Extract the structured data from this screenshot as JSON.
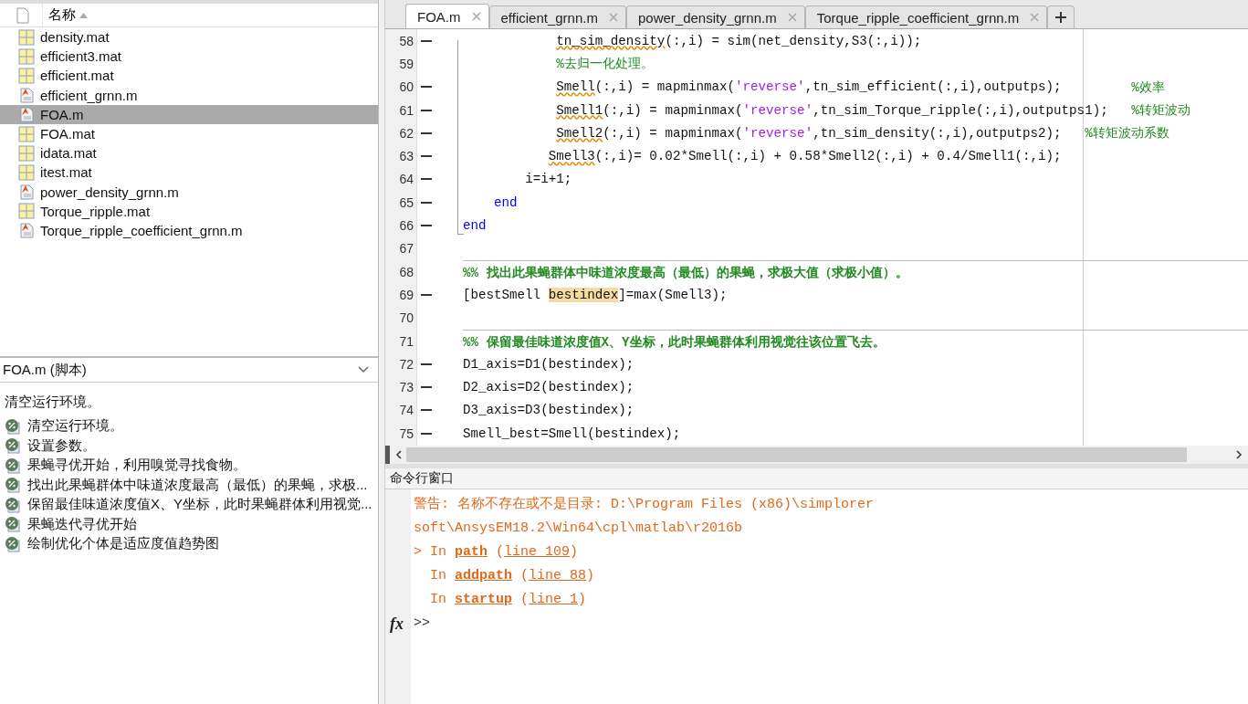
{
  "file_browser": {
    "column": "名称",
    "sort_ascending": true,
    "files": [
      {
        "name": "density.mat",
        "kind": "mat",
        "selected": false
      },
      {
        "name": "efficient3.mat",
        "kind": "mat",
        "selected": false
      },
      {
        "name": "efficient.mat",
        "kind": "mat",
        "selected": false
      },
      {
        "name": "efficient_grnn.m",
        "kind": "m",
        "selected": false
      },
      {
        "name": "FOA.m",
        "kind": "m",
        "selected": true
      },
      {
        "name": "FOA.mat",
        "kind": "mat",
        "selected": false
      },
      {
        "name": "idata.mat",
        "kind": "mat",
        "selected": false
      },
      {
        "name": "itest.mat",
        "kind": "mat",
        "selected": false
      },
      {
        "name": "power_density_grnn.m",
        "kind": "m",
        "selected": false
      },
      {
        "name": "Torque_ripple.mat",
        "kind": "mat",
        "selected": false
      },
      {
        "name": "Torque_ripple_coefficient_grnn.m",
        "kind": "m",
        "selected": false
      }
    ]
  },
  "details": {
    "title": "FOA.m  (脚本)",
    "description": "清空运行环境。",
    "sections": [
      "清空运行环境。",
      "设置参数。",
      "果蝇寻优开始，利用嗅觉寻找食物。",
      "找出此果蝇群体中味道浓度最高（最低）的果蝇，求极...",
      "保留最佳味道浓度值X、Y坐标，此时果蝇群体利用视觉...",
      "果蝇迭代寻优开始",
      "绘制优化个体是适应度值趋势图"
    ]
  },
  "tabs": [
    {
      "label": "FOA.m",
      "selected": true
    },
    {
      "label": "efficient_grnn.m",
      "selected": false
    },
    {
      "label": "power_density_grnn.m",
      "selected": false
    },
    {
      "label": "Torque_ripple_coefficient_grnn.m",
      "selected": false
    }
  ],
  "editor": {
    "lines": [
      {
        "number": "58",
        "executable": true,
        "kind": "code",
        "tokens": [
          {
            "text": "            tn_sim_density",
            "kind": "warn"
          },
          {
            "text": "(:,i) = sim(net_density,S3(:,i));",
            "kind": "plain"
          }
        ]
      },
      {
        "number": "59",
        "executable": false,
        "kind": "code",
        "tokens": [
          {
            "text": "            %去归一化处理。",
            "kind": "comment"
          }
        ]
      },
      {
        "number": "60",
        "executable": true,
        "kind": "code",
        "tokens": [
          {
            "text": "            Smell",
            "kind": "warn"
          },
          {
            "text": "(:,i) = mapminmax(",
            "kind": "plain"
          },
          {
            "text": "'reverse'",
            "kind": "string"
          },
          {
            "text": ",tn_sim_efficient(:,i),outputps);         ",
            "kind": "plain"
          },
          {
            "text": "%效率",
            "kind": "comment"
          }
        ]
      },
      {
        "number": "61",
        "executable": true,
        "kind": "code",
        "tokens": [
          {
            "text": "            Smell1",
            "kind": "warn"
          },
          {
            "text": "(:,i) = mapminmax(",
            "kind": "plain"
          },
          {
            "text": "'reverse'",
            "kind": "string"
          },
          {
            "text": ",tn_sim_Torque_ripple(:,i),outputps1);   ",
            "kind": "plain"
          },
          {
            "text": "%转矩波动",
            "kind": "comment"
          }
        ]
      },
      {
        "number": "62",
        "executable": true,
        "kind": "code",
        "tokens": [
          {
            "text": "            Smell2",
            "kind": "warn"
          },
          {
            "text": "(:,i) = mapminmax(",
            "kind": "plain"
          },
          {
            "text": "'reverse'",
            "kind": "string"
          },
          {
            "text": ",tn_sim_density(:,i),outputps2);   ",
            "kind": "plain"
          },
          {
            "text": "%转矩波动系数",
            "kind": "comment"
          }
        ]
      },
      {
        "number": "63",
        "executable": true,
        "kind": "code",
        "tokens": [
          {
            "text": "           Smell3",
            "kind": "warn"
          },
          {
            "text": "(:,i)= 0.02*Smell(:,i) + 0.58*Smell2(:,i) + 0.4/Smell1(:,i);",
            "kind": "plain"
          }
        ]
      },
      {
        "number": "64",
        "executable": true,
        "kind": "code",
        "tokens": [
          {
            "text": "        i=i+1;",
            "kind": "plain"
          }
        ]
      },
      {
        "number": "65",
        "executable": true,
        "kind": "code",
        "tokens": [
          {
            "text": "    end",
            "kind": "keyword"
          }
        ]
      },
      {
        "number": "66",
        "executable": true,
        "kind": "code",
        "tokens": [
          {
            "text": "end",
            "kind": "keyword"
          }
        ]
      },
      {
        "number": "67",
        "executable": false,
        "kind": "code"
      },
      {
        "number": "68",
        "executable": false,
        "kind": "section",
        "tokens": [
          {
            "text": "%% 找出此果蝇群体中味道浓度最高（最低）的果蝇，求极大值（求极小值）。",
            "kind": "section"
          }
        ]
      },
      {
        "number": "69",
        "executable": true,
        "kind": "code",
        "tokens": [
          {
            "text": "[bestSmell ",
            "kind": "plain"
          },
          {
            "text": "bestindex",
            "kind": "highlight"
          },
          {
            "text": "]=max(Smell3);",
            "kind": "plain"
          }
        ]
      },
      {
        "number": "70",
        "executable": false,
        "kind": "code"
      },
      {
        "number": "71",
        "executable": false,
        "kind": "section",
        "tokens": [
          {
            "text": "%% 保留最佳味道浓度值X、Y坐标，此时果蝇群体利用视觉往该位置飞去。",
            "kind": "section"
          }
        ]
      },
      {
        "number": "72",
        "executable": true,
        "kind": "code",
        "tokens": [
          {
            "text": "D1_axis=D1(bestindex);",
            "kind": "plain"
          }
        ]
      },
      {
        "number": "73",
        "executable": true,
        "kind": "code",
        "tokens": [
          {
            "text": "D2_axis=D2(bestindex);",
            "kind": "plain"
          }
        ]
      },
      {
        "number": "74",
        "executable": true,
        "kind": "code",
        "tokens": [
          {
            "text": "D3_axis=D3(bestindex);",
            "kind": "plain"
          }
        ]
      },
      {
        "number": "75",
        "executable": true,
        "kind": "code",
        "tokens": [
          {
            "text": "Smell_best=Smell(bestindex);",
            "kind": "plain"
          }
        ]
      }
    ]
  },
  "command_window": {
    "title": "命令行窗口",
    "lines": [
      {
        "tokens": [
          {
            "text": "警告: 名称不存在或不是目录: D:\\Program Files (x86)\\simplorer",
            "kind": "text"
          }
        ]
      },
      {
        "tokens": [
          {
            "text": "soft\\AnsysEM18.2\\Win64\\cpl\\matlab\\r2016b",
            "kind": "text"
          }
        ]
      },
      {
        "tokens": [
          {
            "text": "> In ",
            "kind": "text"
          },
          {
            "text": "path",
            "kind": "function"
          },
          {
            "text": " (",
            "kind": "text"
          },
          {
            "text": "line 109",
            "kind": "line_link"
          },
          {
            "text": ")",
            "kind": "text"
          }
        ]
      },
      {
        "tokens": [
          {
            "text": "  In ",
            "kind": "text"
          },
          {
            "text": "addpath",
            "kind": "function"
          },
          {
            "text": " (",
            "kind": "text"
          },
          {
            "text": "line 88",
            "kind": "line_link"
          },
          {
            "text": ")",
            "kind": "text"
          }
        ]
      },
      {
        "tokens": [
          {
            "text": "  In ",
            "kind": "text"
          },
          {
            "text": "startup",
            "kind": "function"
          },
          {
            "text": " (",
            "kind": "text"
          },
          {
            "text": "line 1",
            "kind": "line_link"
          },
          {
            "text": ")",
            "kind": "text"
          }
        ]
      }
    ],
    "fx": "fx",
    "prompt": ">>"
  }
}
